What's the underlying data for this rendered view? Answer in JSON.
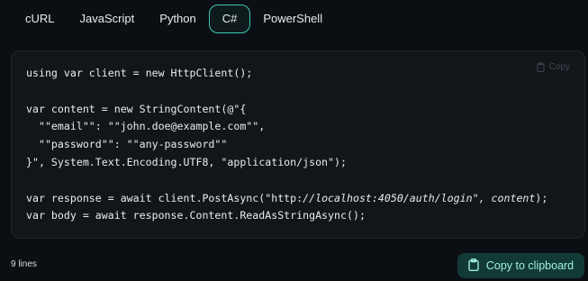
{
  "tabs": [
    {
      "label": "cURL",
      "active": false
    },
    {
      "label": "JavaScript",
      "active": false
    },
    {
      "label": "Python",
      "active": false
    },
    {
      "label": "C#",
      "active": true
    },
    {
      "label": "PowerShell",
      "active": false
    }
  ],
  "code": {
    "copy_label": "Copy",
    "lines": [
      "using var client = new HttpClient();",
      "",
      "var content = new StringContent(@\"{",
      "  \"\"email\"\": \"\"john.doe@example.com\"\",",
      "  \"\"password\"\": \"\"any-password\"\"",
      "}\", System.Text.Encoding.UTF8, \"application/json\");",
      "",
      "var response = await client.PostAsync(\"http://localhost:4050/auth/login\", content);",
      "var body = await response.Content.ReadAsStringAsync();"
    ]
  },
  "footer": {
    "line_count": "9 lines",
    "copy_button_label": "Copy to clipboard"
  },
  "colors": {
    "accent": "#3ec7b3",
    "background": "#0b0f13",
    "panel": "#121619",
    "copy_button_bg": "#123a34",
    "copy_button_text": "#9df0df"
  },
  "icons": {
    "copy": "clipboard-icon"
  }
}
